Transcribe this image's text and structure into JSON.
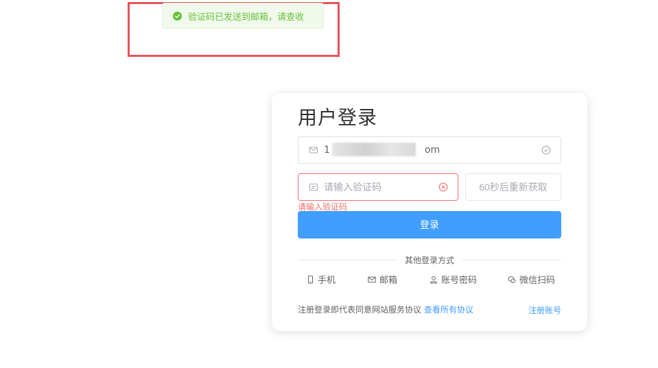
{
  "toast": {
    "message": "验证码已发送到邮箱，请查收",
    "type": "success",
    "color": "#67c23a"
  },
  "login": {
    "title": "用户登录",
    "email": {
      "value_prefix": "1",
      "value_suffix": "om",
      "icon": "envelope-icon",
      "status_icon": "check-circle-icon"
    },
    "code": {
      "placeholder": "请输入验证码",
      "icon": "message-icon",
      "status_icon": "error-circle-icon",
      "error": "请输入验证码"
    },
    "resend_label": "60秒后重新获取",
    "submit_label": "登录",
    "divider_label": "其他登录方式",
    "methods": [
      {
        "label": "手机",
        "icon": "phone-icon"
      },
      {
        "label": "邮箱",
        "icon": "mail-icon"
      },
      {
        "label": "账号密码",
        "icon": "user-icon"
      },
      {
        "label": "微信扫码",
        "icon": "wechat-icon"
      }
    ],
    "agreement_text": "注册登录即代表同意网站服务协议",
    "agreement_link": "查看所有协议",
    "register_label": "注册账号"
  },
  "colors": {
    "primary": "#409eff",
    "error": "#f56c6c",
    "highlight": "#e8525a"
  }
}
